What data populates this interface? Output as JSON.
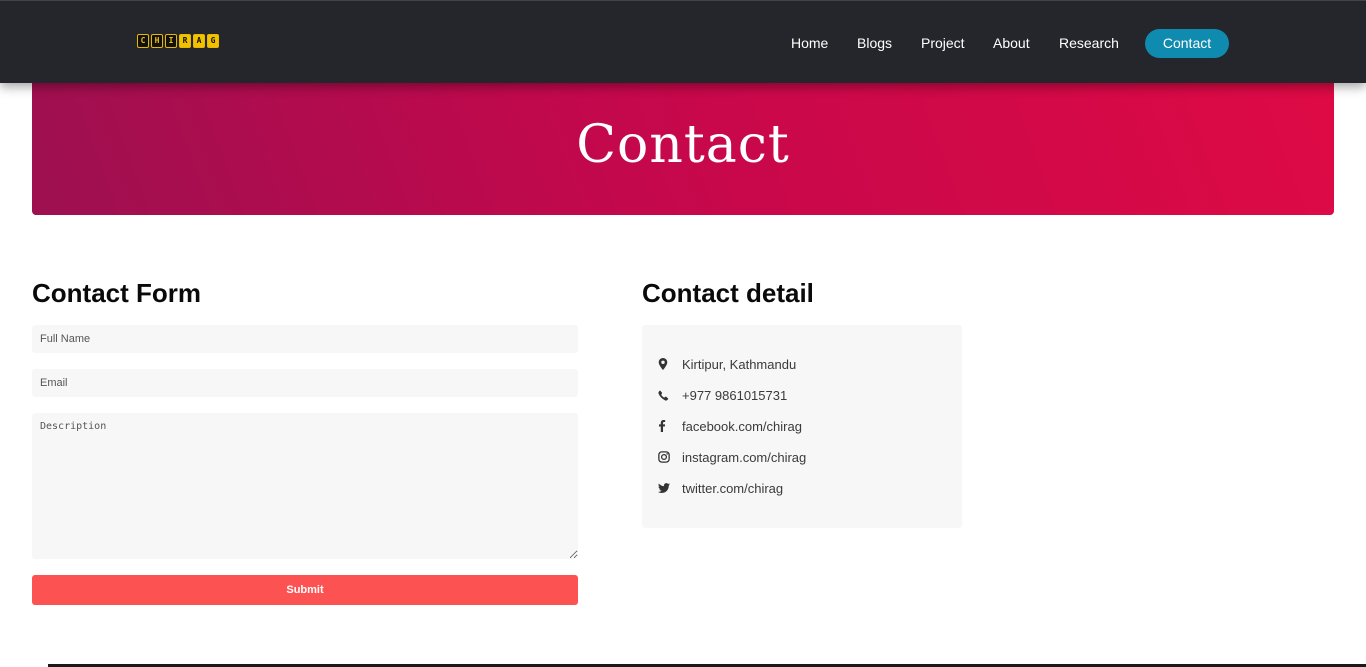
{
  "logo": {
    "letters": [
      "C",
      "H",
      "I",
      "R",
      "A",
      "G"
    ]
  },
  "nav": {
    "items": [
      {
        "label": "Home"
      },
      {
        "label": "Blogs"
      },
      {
        "label": "Project"
      },
      {
        "label": "About"
      },
      {
        "label": "Research"
      },
      {
        "label": "Contact",
        "active": true
      }
    ]
  },
  "hero": {
    "title": "Contact"
  },
  "form": {
    "title": "Contact Form",
    "full_name_placeholder": "Full Name",
    "email_placeholder": "Email",
    "description_placeholder": "Description",
    "submit_label": "Submit"
  },
  "details": {
    "title": "Contact detail",
    "items": [
      {
        "icon": "map-marker-icon",
        "text": "Kirtipur, Kathmandu"
      },
      {
        "icon": "phone-icon",
        "text": "+977 9861015731"
      },
      {
        "icon": "facebook-icon",
        "text": "facebook.com/chirag"
      },
      {
        "icon": "instagram-icon",
        "text": "instagram.com/chirag"
      },
      {
        "icon": "twitter-icon",
        "text": "twitter.com/chirag"
      }
    ]
  },
  "colors": {
    "navbar_bg": "#25262b",
    "nav_active": "#0f8bb0",
    "hero_gradient": [
      "#9d1050",
      "#de0a45"
    ],
    "submit_bg": "#fd5252"
  }
}
